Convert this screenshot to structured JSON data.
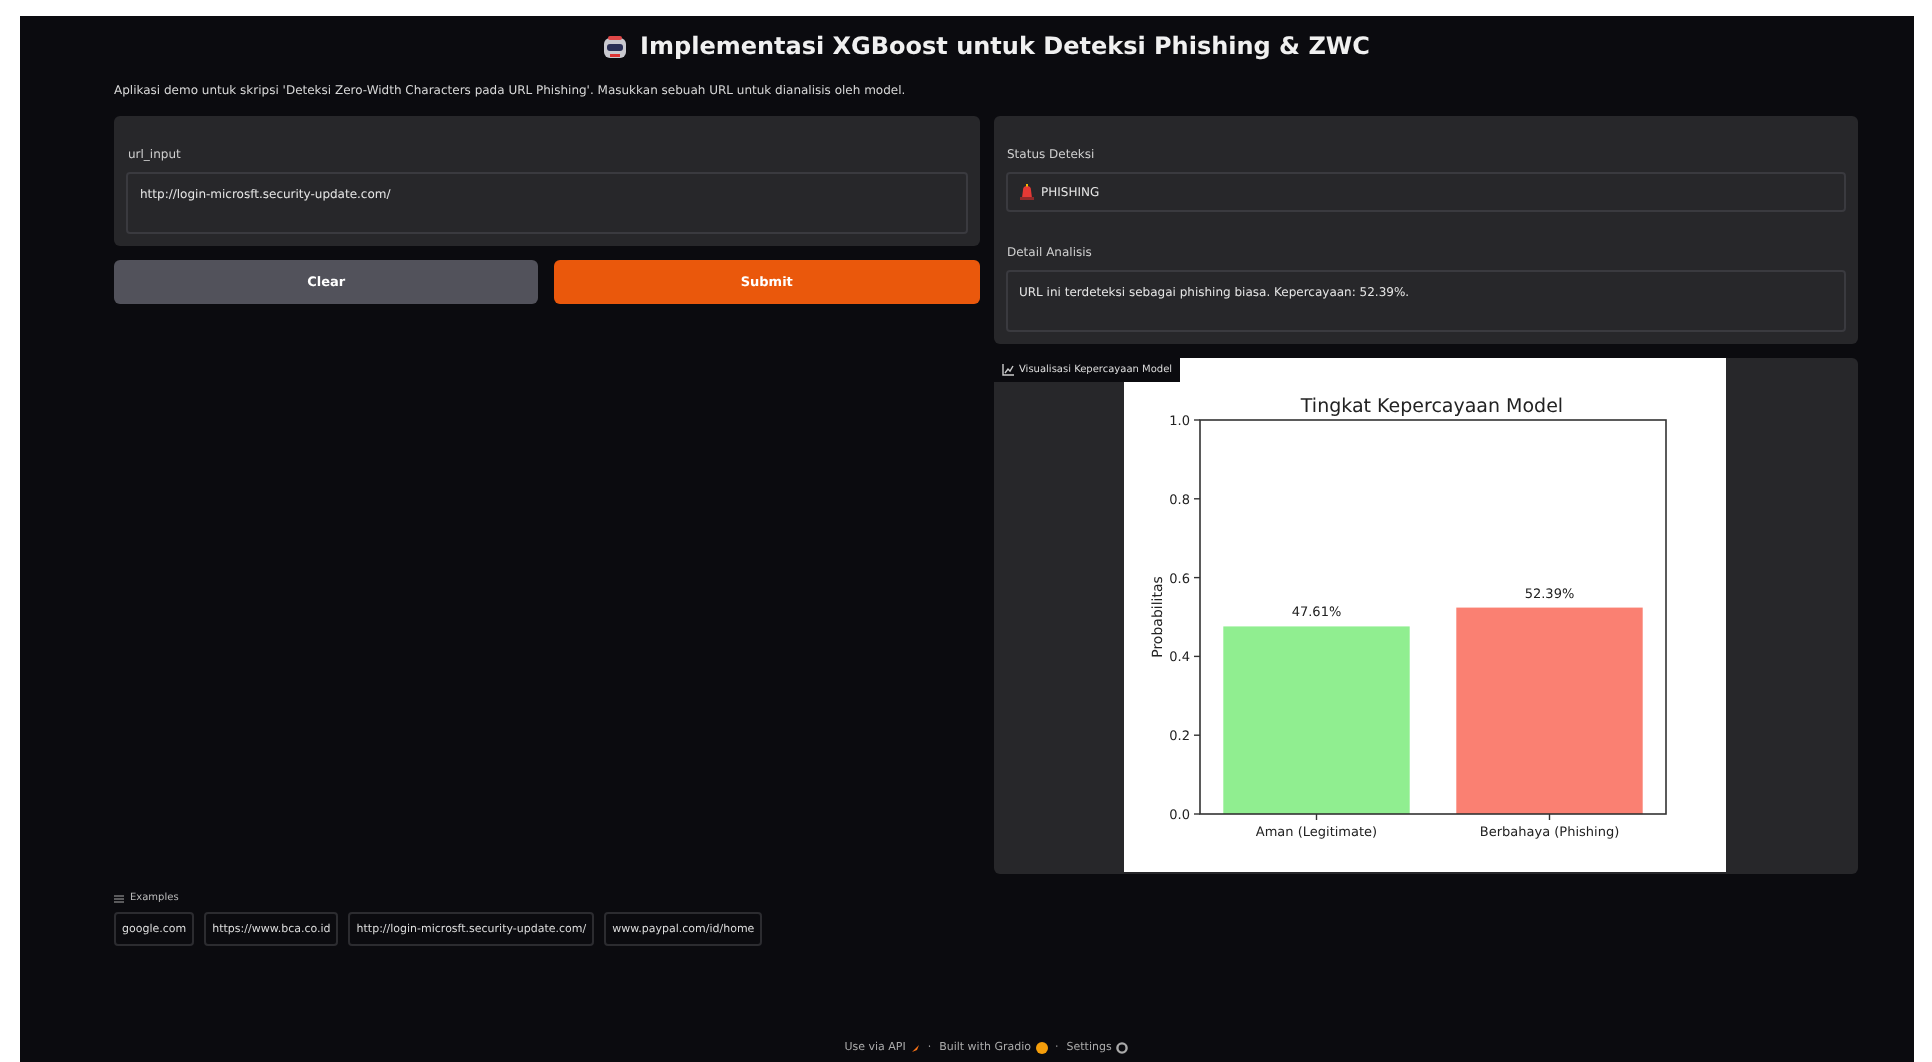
{
  "header": {
    "title": "Implementasi XGBoost untuk Deteksi Phishing & ZWC",
    "description": "Aplikasi demo untuk skripsi 'Deteksi Zero-Width Characters pada URL Phishing'. Masukkan sebuah URL untuk dianalisis oleh model."
  },
  "input": {
    "label": "url_input",
    "value": "http://login-microsft.security-update.com/"
  },
  "buttons": [
    {
      "label": "Clear",
      "kind": "secondary"
    },
    {
      "label": "Submit",
      "kind": "primary"
    }
  ],
  "status": {
    "label": "Status Deteksi",
    "value": "PHISHING"
  },
  "detail": {
    "label": "Detail Analisis",
    "value": "URL ini terdeteksi sebagai phishing biasa. Kepercayaan: 52.39%."
  },
  "plot": {
    "label": "Visualisasi Kepercayaan Model",
    "chart_data": {
      "type": "bar",
      "title": "Tingkat Kepercayaan Model",
      "ylabel": "Probabilitas",
      "categories": [
        "Aman (Legitimate)",
        "Berbahaya (Phishing)"
      ],
      "series": [
        {
          "color": "#90ee90",
          "values": [
            0.4761,
            null
          ]
        },
        {
          "color": "#fa8072",
          "values": [
            null,
            0.5239
          ]
        }
      ],
      "ylim": [
        0,
        1
      ],
      "yticks": [
        {
          "value": 0,
          "label": "0.0"
        },
        {
          "value": 0.2,
          "label": "0.2"
        },
        {
          "value": 0.4,
          "label": "0.4"
        },
        {
          "value": 0.6,
          "label": "0.6"
        },
        {
          "value": 0.8,
          "label": "0.8"
        },
        {
          "value": 1,
          "label": "1.0"
        }
      ],
      "value_labels": [
        "47.61%",
        "52.39%"
      ]
    }
  },
  "examples": {
    "label": "Examples",
    "items": [
      "google.com",
      "https://www.bca.co.id",
      "http://login-microsft.security-update.com/",
      "www.paypal.com/id/home"
    ]
  },
  "footer": [
    {
      "kind": "link",
      "label": "Use via API"
    },
    {
      "kind": "separator",
      "label": "·"
    },
    {
      "kind": "link",
      "label": "Built with Gradio"
    },
    {
      "kind": "separator",
      "label": "·"
    },
    {
      "kind": "link",
      "label": "Settings"
    }
  ]
}
